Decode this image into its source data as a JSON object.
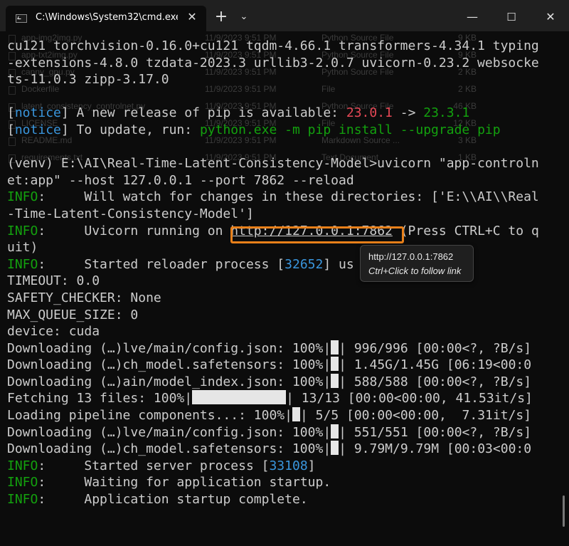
{
  "window": {
    "tab_title": "C:\\Windows\\System32\\cmd.exe",
    "new_tab_glyph": "+",
    "dropdown_glyph": "⌄",
    "minimize_glyph": "—",
    "maximize_glyph": "☐",
    "close_glyph": "✕",
    "tab_close_glyph": "✕"
  },
  "background_listing": [
    {
      "name": "app-img2img.py",
      "date": "11/9/2023 9:51 PM",
      "type": "Python Source File",
      "size": "9 KB"
    },
    {
      "name": "app-txt2img.py",
      "date": "11/9/2023 9:51 PM",
      "type": "Python Source File",
      "size": "9 KB"
    },
    {
      "name": "canny_gpu.py",
      "date": "11/9/2023 9:51 PM",
      "type": "Python Source File",
      "size": "2 KB"
    },
    {
      "name": "Dockerfile",
      "date": "11/9/2023 9:51 PM",
      "type": "File",
      "size": "2 KB"
    },
    {
      "name": "latent_consistency_controlnet.py",
      "date": "11/9/2023 9:51 PM",
      "type": "Python Source File",
      "size": "46 KB"
    },
    {
      "name": "LICENSE",
      "date": "11/9/2023 9:51 PM",
      "type": "File",
      "size": "12 KB"
    },
    {
      "name": "README.md",
      "date": "11/9/2023 9:51 PM",
      "type": "Markdown Source ...",
      "size": "3 KB"
    },
    {
      "name": "requirements.txt",
      "date": "11/9/2023 9:51 PM",
      "type": "Text Document",
      "size": "1 KB"
    }
  ],
  "terminal": {
    "l1": "cu121 torchvision-0.16.0+cu121 tqdm-4.66.1 transformers-4.34.1 typing",
    "l2": "-extensions-4.8.0 tzdata-2023.3 urllib3-2.0.7 uvicorn-0.23.2 websocke",
    "l3": "ts-11.0.3 zipp-3.17.0",
    "notice_word": "notice",
    "pip_msg": " A new release of pip is available: ",
    "pip_old": "23.0.1",
    "pip_arrow": " -> ",
    "pip_new": "23.3.1",
    "update_msg": " To update, run: ",
    "update_cmd": "python.exe -m pip install --upgrade pip",
    "cmd1": "(venv) E:\\AI\\Real-Time-Latent-Consistency-Model>uvicorn \"app-controln",
    "cmd2": "et:app\" --host 127.0.0.1 --port 7862 --reload",
    "info": "INFO",
    "watch1": ":     Will watch for changes in these directories: ['E:\\\\AI\\\\Real",
    "watch2": "-Time-Latent-Consistency-Model']",
    "running_pre": ":     Uvicorn running on ",
    "running_url": "http://127.0.0.1:7862",
    "running_post": " (Press CTRL+C to q",
    "running2": "uit)",
    "reloader_pre": ":     Started reloader process [",
    "reloader_pid": "32652",
    "reloader_post": "] us",
    "timeout": "TIMEOUT: 0.0",
    "safety": "SAFETY_CHECKER: None",
    "queue": "MAX_QUEUE_SIZE: 0",
    "device": "device: cuda",
    "dl1_pre": "Downloading (…)lve/main/config.json: 100%|",
    "dl1_post": "| 996/996 [00:00<?, ?B/s]",
    "dl2_pre": "Downloading (…)ch_model.safetensors: 100%|",
    "dl2_post": "| 1.45G/1.45G [06:19<00:0",
    "dl3_pre": "Downloading (…)ain/model_index.json: 100%|",
    "dl3_post": "| 588/588 [00:00<?, ?B/s]",
    "fetch_pre": "Fetching 13 files: 100%|",
    "fetch_post": "| 13/13 [00:00<00:00, 41.53it/s]",
    "load_pre": "Loading pipeline components...: 100%|",
    "load_post": "| 5/5 [00:00<00:00,  7.31it/s]",
    "dl4_pre": "Downloading (…)lve/main/config.json: 100%|",
    "dl4_post": "| 551/551 [00:00<?, ?B/s]",
    "dl5_pre": "Downloading (…)ch_model.safetensors: 100%|",
    "dl5_post": "| 9.79M/9.79M [00:03<00:0",
    "server_pre": ":     Started server process [",
    "server_pid": "33108",
    "server_post": "]",
    "waiting": ":     Waiting for application startup.",
    "complete": ":     Application startup complete."
  },
  "tooltip": {
    "url": "http://127.0.0.1:7862",
    "hint": "Ctrl+Click to follow link"
  },
  "colors": {
    "background": "#0c0c0c",
    "text": "#cccccc",
    "info_green": "#13a10e",
    "notice_blue": "#3a96dd",
    "version_red": "#e74856",
    "highlight_orange": "#e8801a"
  }
}
